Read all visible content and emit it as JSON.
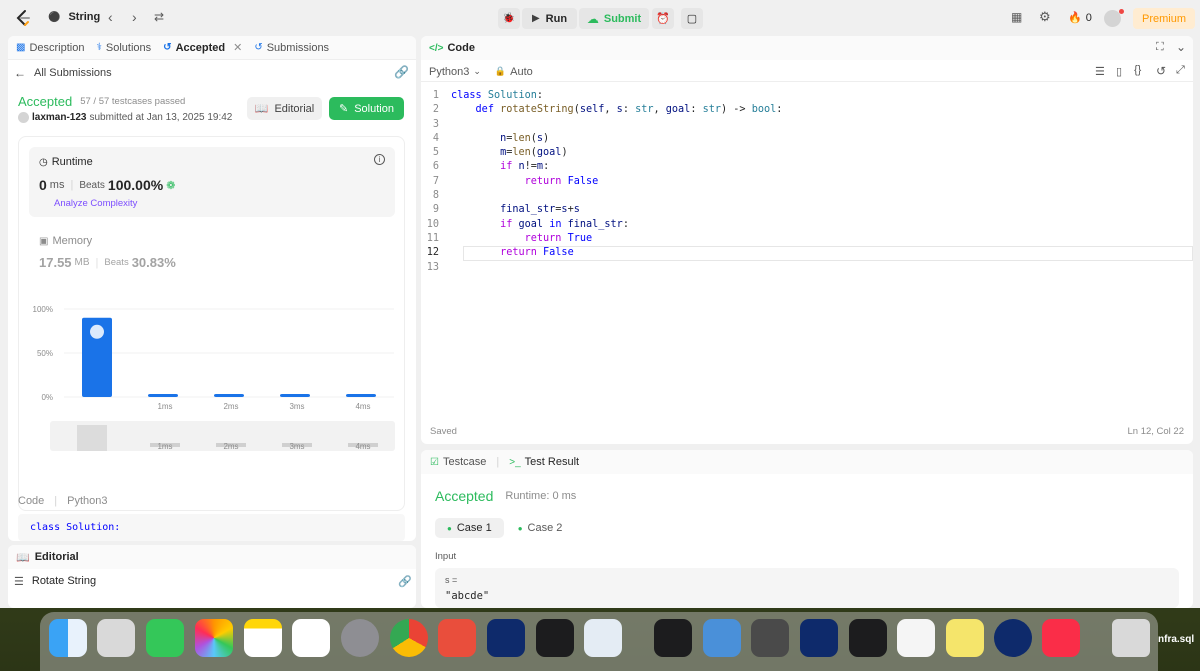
{
  "topbar": {
    "problem_title": "String",
    "run_label": "Run",
    "submit_label": "Submit",
    "streak_count": "0",
    "premium_label": "Premium"
  },
  "left": {
    "tabs": [
      {
        "label": "Description"
      },
      {
        "label": "Solutions"
      },
      {
        "label": "Accepted"
      },
      {
        "label": "Submissions"
      }
    ],
    "back_label": "All Submissions",
    "status": "Accepted",
    "testcases": "57 / 57 testcases passed",
    "user": "laxman-123",
    "submitted_text": "submitted at Jan 13, 2025 19:42",
    "editorial_btn": "Editorial",
    "solution_btn": "Solution",
    "runtime": {
      "title": "Runtime",
      "value": "0",
      "unit": "ms",
      "beats_label": "Beats",
      "beats_value": "100.00%",
      "analyze": "Analyze Complexity"
    },
    "memory": {
      "title": "Memory",
      "value": "17.55",
      "unit": "MB",
      "beats_label": "Beats",
      "beats_value": "30.83%"
    },
    "code_label": "Code",
    "code_lang": "Python3",
    "code_preview": "class Solution:",
    "editorial_panel": {
      "title": "Editorial",
      "item": "Rotate String"
    }
  },
  "chart_data": {
    "type": "bar",
    "categories": [
      "",
      "1ms",
      "2ms",
      "3ms",
      "4ms"
    ],
    "values": [
      90,
      2,
      2,
      2,
      2
    ],
    "ytick_labels": [
      "100%",
      "50%",
      "0%"
    ],
    "ylim": [
      0,
      100
    ],
    "highlight_index": 0,
    "mini_tick_labels": [
      "1ms",
      "2ms",
      "3ms",
      "4ms"
    ],
    "bar_color": "#1a73e8"
  },
  "editor": {
    "title": "Code",
    "language": "Python3",
    "mode": "Auto",
    "lines": [
      {
        "n": "1"
      },
      {
        "n": "2"
      },
      {
        "n": "3"
      },
      {
        "n": "4"
      },
      {
        "n": "5"
      },
      {
        "n": "6"
      },
      {
        "n": "7"
      },
      {
        "n": "8"
      },
      {
        "n": "9"
      },
      {
        "n": "10"
      },
      {
        "n": "11"
      },
      {
        "n": "12"
      },
      {
        "n": "13"
      }
    ],
    "saved_label": "Saved",
    "cursor_pos": "Ln 12, Col 22"
  },
  "result": {
    "tab_testcase": "Testcase",
    "tab_result": "Test Result",
    "status": "Accepted",
    "runtime": "Runtime: 0 ms",
    "case1": "Case 1",
    "case2": "Case 2",
    "input_label": "Input",
    "var_name": "s =",
    "var_value": "\"abcde\""
  },
  "dock": {
    "label_partial": "nfra.sql"
  },
  "colors": {
    "accent_green": "#2cbb5d",
    "bar_blue": "#1a73e8",
    "premium_bg": "#ffecd1",
    "premium_text": "#ff9900"
  }
}
